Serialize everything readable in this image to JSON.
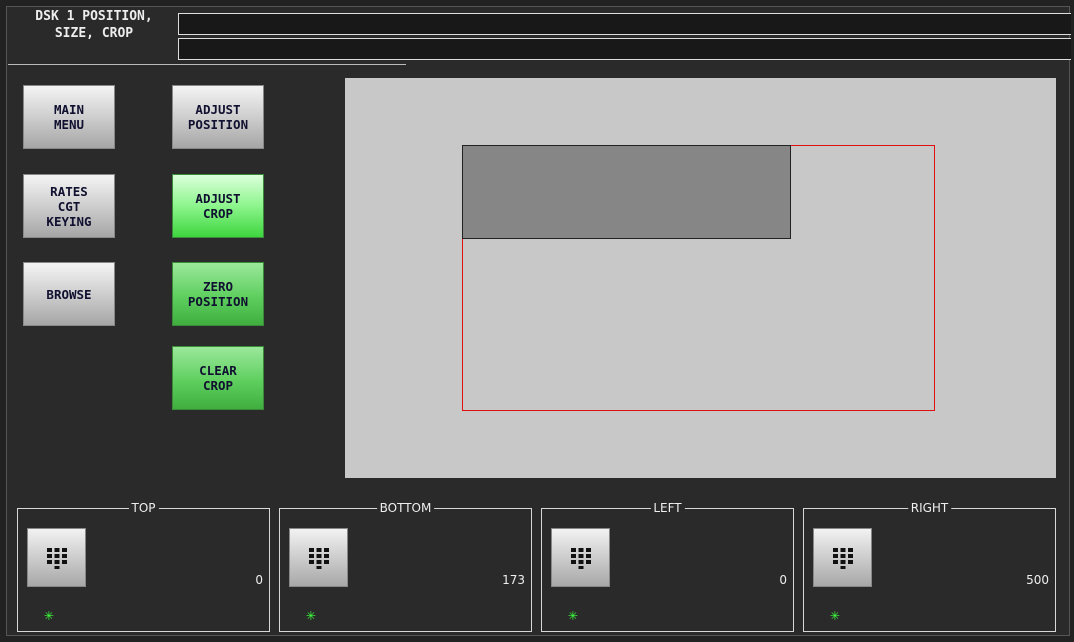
{
  "header": {
    "title": "DSK 1 POSITION,\nSIZE, CROP",
    "message_line_1": "",
    "message_line_2": ""
  },
  "buttons": {
    "main_menu": "MAIN\nMENU",
    "rates": "RATES\nCGT\nKEYING",
    "browse": "BROWSE",
    "adjust_position": "ADJUST\nPOSITION",
    "adjust_crop": "ADJUST\nCROP",
    "zero_position": "ZERO\nPOSITION",
    "clear_crop": "CLEAR\nCROP"
  },
  "active_mode": "adjust_crop",
  "colors": {
    "active_green": "#5fe05f",
    "green_button": "#5ecf5e",
    "grey_button": "#c8c8c8",
    "raster_outline": "#e01010",
    "crop_fill": "#868686",
    "preview_bg": "#c8c8c8",
    "status_indicator": "#3cff3c"
  },
  "panels": [
    {
      "label": "TOP",
      "value": "0",
      "icon": "keypad-icon",
      "status_icon": "green-star-icon"
    },
    {
      "label": "BOTTOM",
      "value": "173",
      "icon": "keypad-icon",
      "status_icon": "green-star-icon"
    },
    {
      "label": "LEFT",
      "value": "0",
      "icon": "keypad-icon",
      "status_icon": "green-star-icon"
    },
    {
      "label": "RIGHT",
      "value": "500",
      "icon": "keypad-icon",
      "status_icon": "green-star-icon"
    }
  ]
}
